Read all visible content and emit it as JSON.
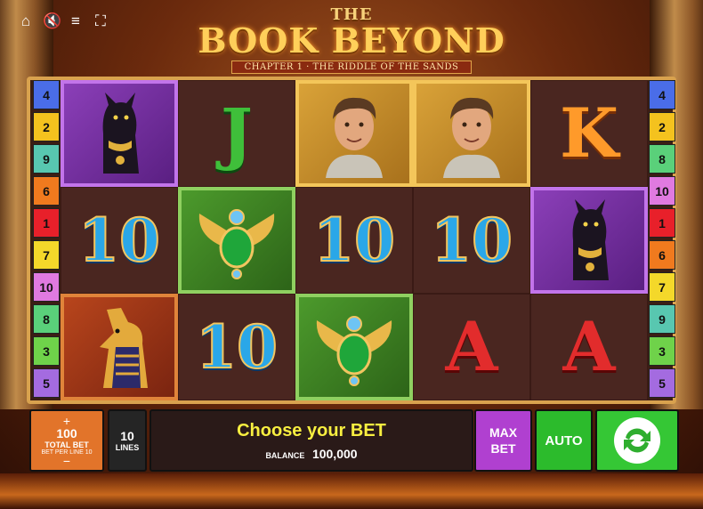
{
  "logo": {
    "the": "THE",
    "title": "BOOK BEYOND",
    "subtitle": "CHAPTER 1 · THE RIDDLE OF THE SANDS"
  },
  "topbar": {
    "icons": [
      "home-icon",
      "sound-muted-icon",
      "menu-icon",
      "fullscreen-icon"
    ]
  },
  "paylines": {
    "left": [
      "4",
      "2",
      "9",
      "6",
      "1",
      "7",
      "10",
      "8",
      "3",
      "5"
    ],
    "right": [
      "4",
      "2",
      "8",
      "10",
      "1",
      "6",
      "7",
      "9",
      "3",
      "5"
    ],
    "colors": {
      "1": "#e8202a",
      "2": "#f4c21e",
      "3": "#6fd24a",
      "4": "#4a6de8",
      "5": "#a46be0",
      "6": "#f07a1e",
      "7": "#f4d82a",
      "8": "#5ad07a",
      "9": "#58c7b0",
      "10": "#e07ae0"
    }
  },
  "reels": {
    "rows": [
      [
        {
          "sym": "cat",
          "label": "",
          "hl": "purple"
        },
        {
          "sym": "J",
          "label": "J",
          "hl": ""
        },
        {
          "sym": "explorer",
          "label": "",
          "hl": "gold"
        },
        {
          "sym": "explorer",
          "label": "",
          "hl": "gold"
        },
        {
          "sym": "K",
          "label": "K",
          "hl": ""
        }
      ],
      [
        {
          "sym": "10",
          "label": "10",
          "hl": ""
        },
        {
          "sym": "scarab",
          "label": "",
          "hl": "green"
        },
        {
          "sym": "10",
          "label": "10",
          "hl": ""
        },
        {
          "sym": "10",
          "label": "10",
          "hl": ""
        },
        {
          "sym": "cat",
          "label": "",
          "hl": "purple"
        }
      ],
      [
        {
          "sym": "anubis",
          "label": "",
          "hl": "red"
        },
        {
          "sym": "10",
          "label": "10",
          "hl": ""
        },
        {
          "sym": "scarab",
          "label": "",
          "hl": "green"
        },
        {
          "sym": "A",
          "label": "A",
          "hl": ""
        },
        {
          "sym": "A",
          "label": "A",
          "hl": ""
        }
      ]
    ]
  },
  "controls": {
    "bet": {
      "plus": "+",
      "amount": "100",
      "label": "TOTAL BET",
      "per_line": "BET PER LINE 10",
      "minus": "−"
    },
    "lines": {
      "value": "10",
      "label": "LINES"
    },
    "message": "Choose your BET",
    "balance_label": "BALANCE",
    "balance_value": "100,000",
    "max_bet": "MAX BET",
    "auto": "AUTO",
    "spin_icon": "spin-arrows-icon"
  }
}
